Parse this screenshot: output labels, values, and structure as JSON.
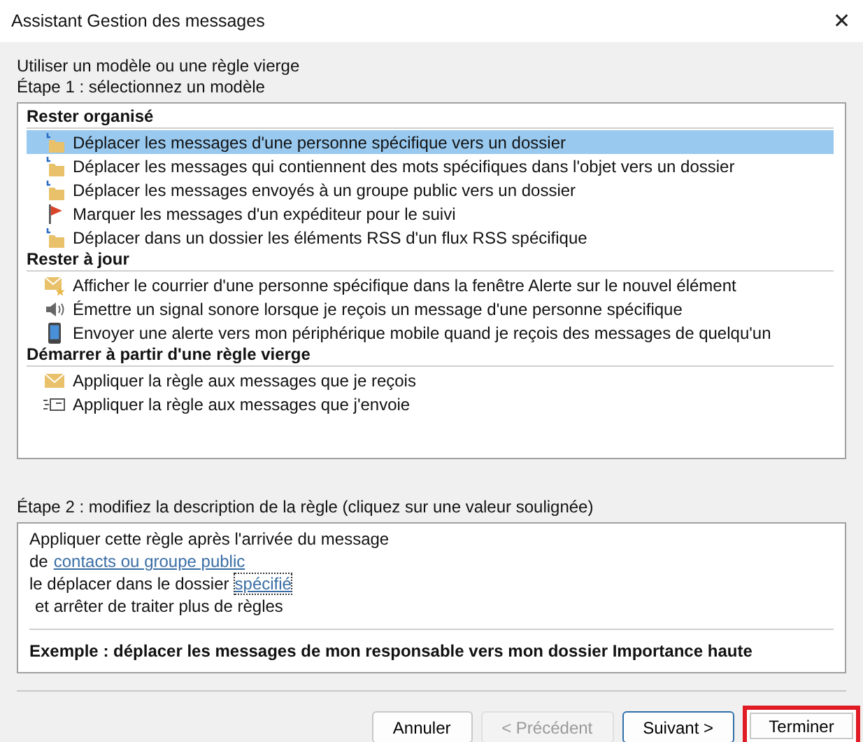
{
  "window": {
    "title": "Assistant Gestion des messages",
    "close": "✕"
  },
  "intro": "Utiliser un modèle ou une règle vierge",
  "step1": "Étape 1 : sélectionnez un modèle",
  "groups": [
    {
      "title": "Rester organisé",
      "items": [
        {
          "kind": "move",
          "label": "Déplacer les messages d'une personne spécifique vers un dossier",
          "selected": true
        },
        {
          "kind": "move",
          "label": "Déplacer les messages qui contiennent des mots spécifiques dans l'objet vers un dossier",
          "selected": false
        },
        {
          "kind": "move",
          "label": "Déplacer les messages envoyés à un groupe public vers un dossier",
          "selected": false
        },
        {
          "kind": "flag",
          "label": "Marquer les messages d'un expéditeur pour le suivi",
          "selected": false
        },
        {
          "kind": "move",
          "label": "Déplacer dans un dossier les éléments RSS d'un flux RSS spécifique",
          "selected": false
        }
      ]
    },
    {
      "title": "Rester à jour",
      "items": [
        {
          "kind": "alert",
          "label": "Afficher le courrier d'une personne spécifique dans la fenêtre Alerte sur le nouvel élément",
          "selected": false
        },
        {
          "kind": "sound",
          "label": "Émettre un signal sonore lorsque je reçois un message d'une personne spécifique",
          "selected": false
        },
        {
          "kind": "mobile",
          "label": "Envoyer une alerte vers mon périphérique mobile quand je reçois des messages de quelqu'un",
          "selected": false
        }
      ]
    },
    {
      "title": "Démarrer à partir d'une règle vierge",
      "items": [
        {
          "kind": "mail",
          "label": "Appliquer la règle aux messages que je reçois",
          "selected": false
        },
        {
          "kind": "send",
          "label": "Appliquer la règle aux messages que j'envoie",
          "selected": false
        }
      ]
    }
  ],
  "step2": "Étape 2 : modifiez la description de la règle (cliquez sur une valeur soulignée)",
  "description": [
    [
      {
        "kind": "text",
        "text": "Appliquer cette règle après l'arrivée du message"
      }
    ],
    [
      {
        "kind": "text",
        "text": "de"
      },
      {
        "kind": "link",
        "text": "contacts ou groupe public",
        "focused": false
      }
    ],
    [
      {
        "kind": "text",
        "text": "le déplacer dans le dossier"
      },
      {
        "kind": "link",
        "text": "spécifié",
        "focused": true
      }
    ],
    [
      {
        "kind": "text",
        "text": "et arrêter de traiter plus de règles",
        "indent": true
      }
    ]
  ],
  "example": "Exemple : déplacer les messages de mon responsable vers mon dossier Importance haute",
  "buttons": [
    {
      "label": "Annuler",
      "disabled": false,
      "default": false,
      "highlighted": false
    },
    {
      "label": "< Précédent",
      "disabled": true,
      "default": false,
      "highlighted": false
    },
    {
      "label": "Suivant >",
      "disabled": false,
      "default": true,
      "highlighted": false
    },
    {
      "label": "Terminer",
      "disabled": false,
      "default": false,
      "highlighted": true
    }
  ]
}
